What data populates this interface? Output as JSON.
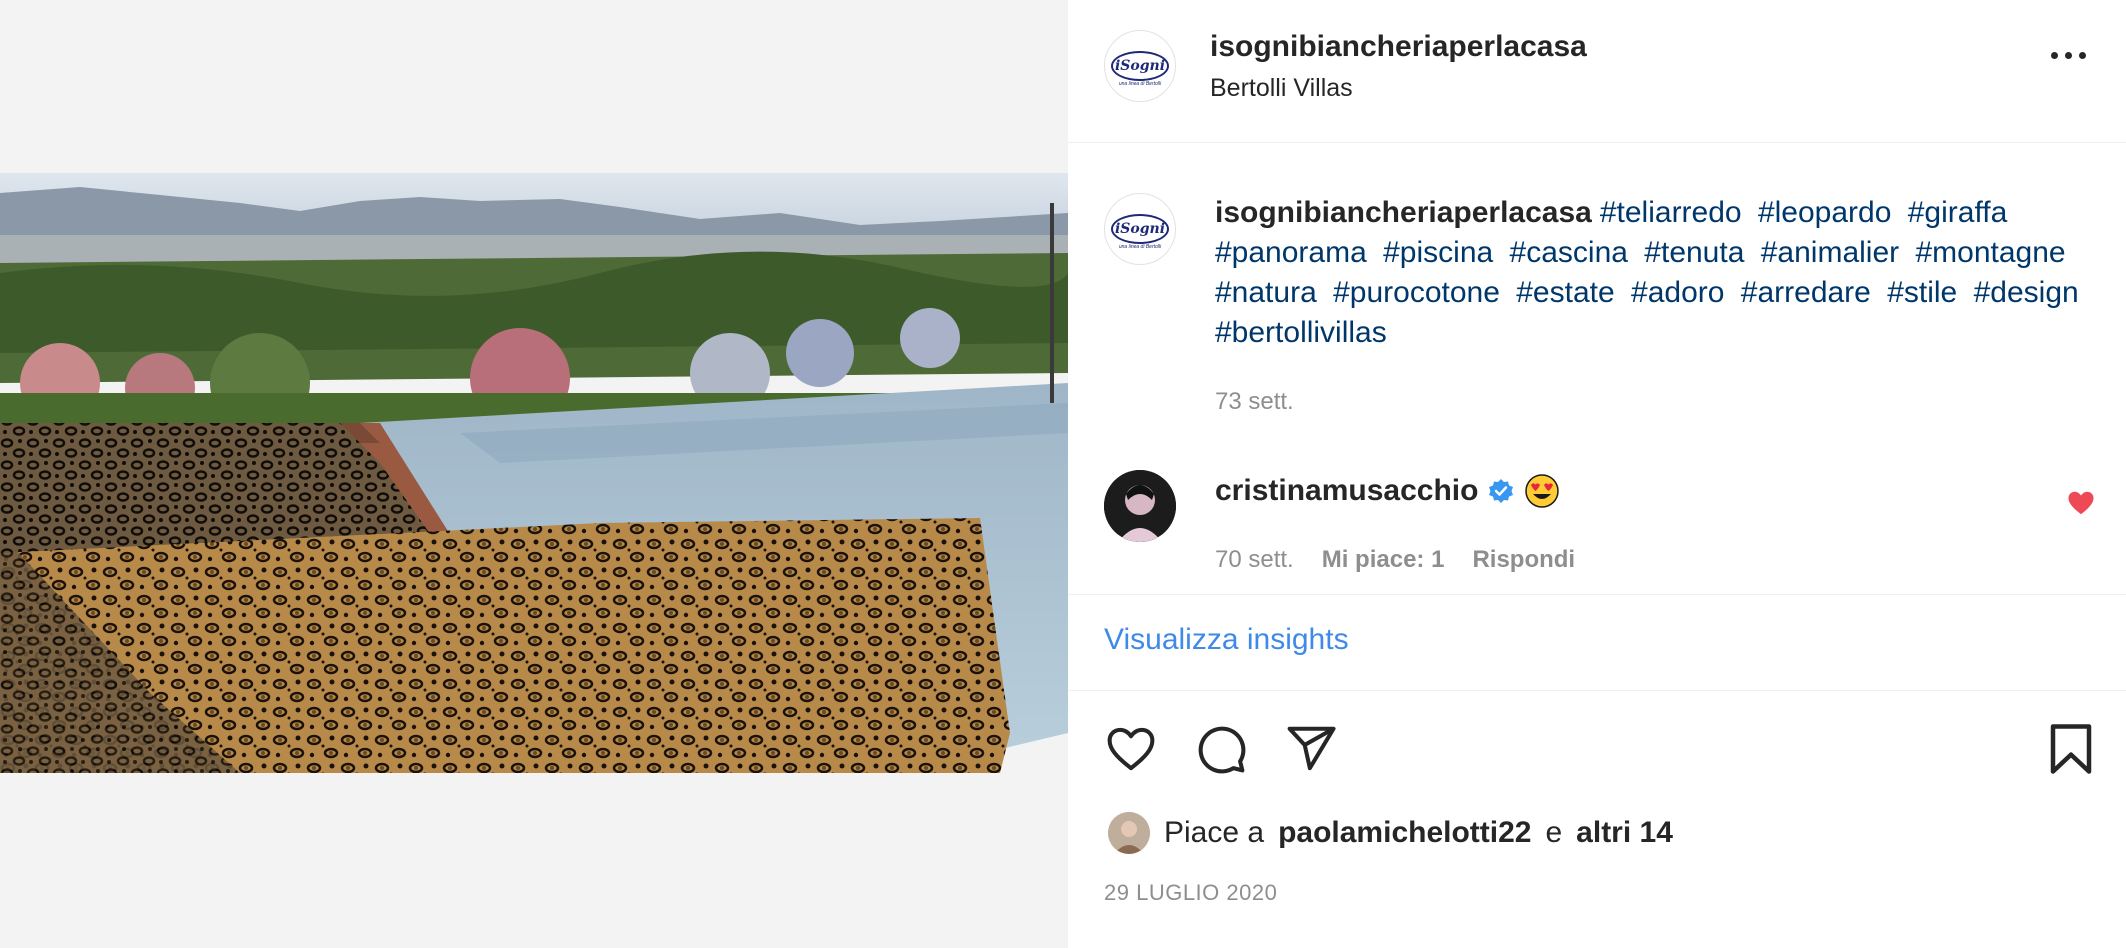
{
  "post": {
    "username": "isognibiancheriaperlacasa",
    "location": "Bertolli Villas",
    "logo_text": "iSogni",
    "logo_tagline": "una linea di Bertolli"
  },
  "caption": {
    "username": "isognibiancheriaperlacasa",
    "hashtags": [
      "#teliarredo",
      "#leopardo",
      "#giraffa",
      "#panorama",
      "#piscina",
      "#cascina",
      "#tenuta",
      "#animalier",
      "#montagne",
      "#natura",
      "#purocotone",
      "#estate",
      "#adoro",
      "#arredare",
      "#stile",
      "#design",
      "#bertollivillas"
    ],
    "time": "73 sett."
  },
  "comment": {
    "username": "cristinamusacchio",
    "emoji": "heart-eyes-emoji",
    "time": "70 sett.",
    "likes": "Mi piace: 1",
    "reply": "Rispondi"
  },
  "insights_label": "Visualizza insights",
  "likes_line": {
    "prefix": "Piace a",
    "user": "paolamichelotti22",
    "conj": "e",
    "others": "altri 14"
  },
  "date": "29 LUGLIO 2020",
  "icons": {
    "like": "heart-icon",
    "comment": "comment-icon",
    "share": "share-icon",
    "save": "bookmark-icon",
    "comment_liked": "filled-heart-icon",
    "verified": "verified-badge-icon"
  },
  "colors": {
    "hashtag": "#00376b",
    "link": "#3f8ae8",
    "liked": "#ed4956",
    "verified": "#3897f0",
    "muted": "#8e8e8e"
  }
}
